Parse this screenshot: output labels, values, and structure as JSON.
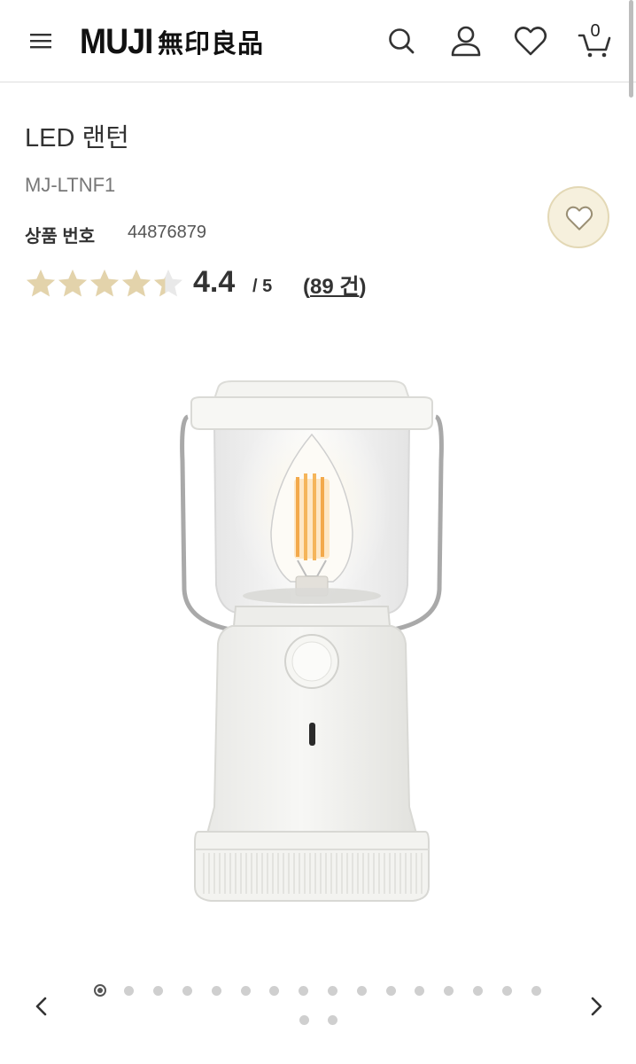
{
  "header": {
    "logo_latin": "MUJI",
    "logo_kanji": "無印良品",
    "cart_count": "0",
    "icons": [
      "menu-icon",
      "search-icon",
      "user-icon",
      "heart-icon",
      "cart-icon"
    ]
  },
  "product": {
    "title": "LED 랜턴",
    "model": "MJ-LTNF1",
    "product_number_label": "상품 번호",
    "product_number": "44876879",
    "rating": "4.4",
    "rating_max": "/ 5",
    "review_open": "(",
    "review_count": "89 건",
    "review_close": ")",
    "rating_value": 4.4,
    "star_color": "#e3d3ab",
    "star_empty_color": "#e9e9e9"
  },
  "carousel": {
    "total": 18,
    "active_index": 0
  },
  "colors": {
    "accent_fav_bg": "#f6f0dd",
    "accent_fav_border": "#e3d8b5"
  }
}
